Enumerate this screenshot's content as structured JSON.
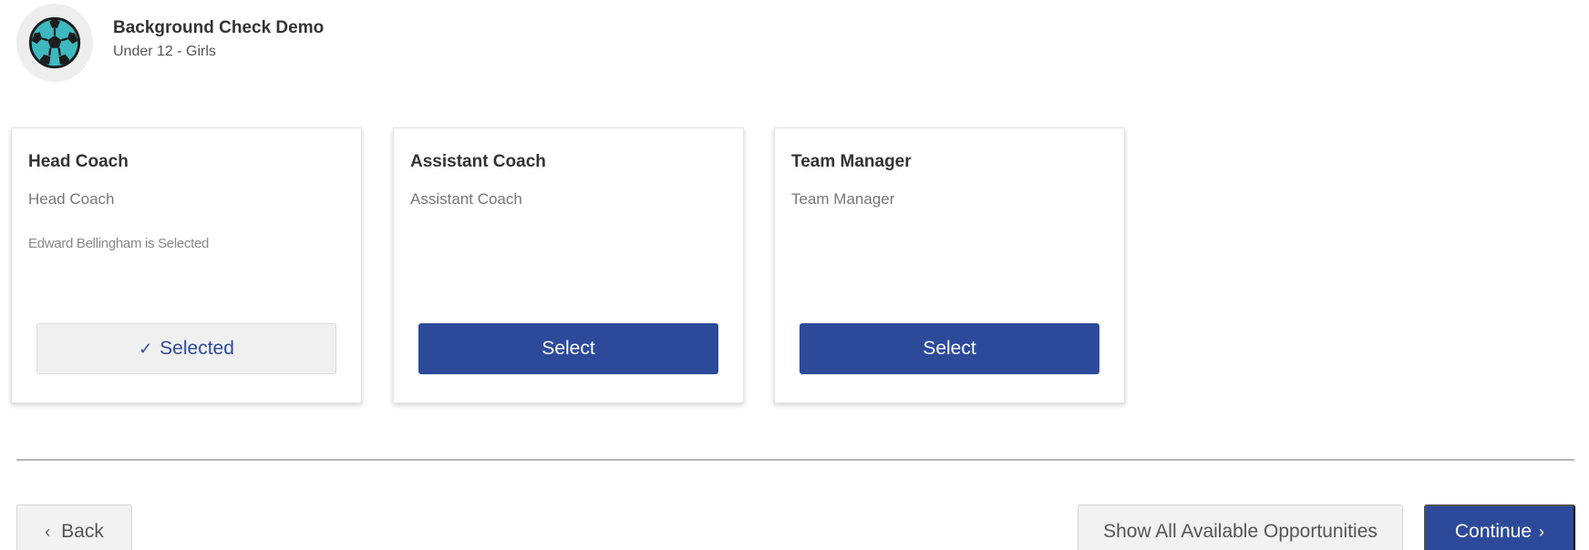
{
  "header": {
    "org_name": "Background Check Demo",
    "division": "Under 12 - Girls",
    "logo_icon": "soccer-ball-icon"
  },
  "roles": [
    {
      "title": "Head Coach",
      "subtitle": "Head Coach",
      "note": "Edward Bellingham is Selected",
      "button_label": "Selected",
      "selected": true
    },
    {
      "title": "Assistant Coach",
      "subtitle": "Assistant Coach",
      "note": "",
      "button_label": "Select",
      "selected": false
    },
    {
      "title": "Team Manager",
      "subtitle": "Team Manager",
      "note": "",
      "button_label": "Select",
      "selected": false
    }
  ],
  "footer": {
    "back_label": "Back",
    "show_all_label": "Show All Available Opportunities",
    "continue_label": "Continue"
  },
  "colors": {
    "primary": "#2d4a9a",
    "logo_accent": "#3fb8c0",
    "secondary_bg": "#f2f2f2"
  }
}
